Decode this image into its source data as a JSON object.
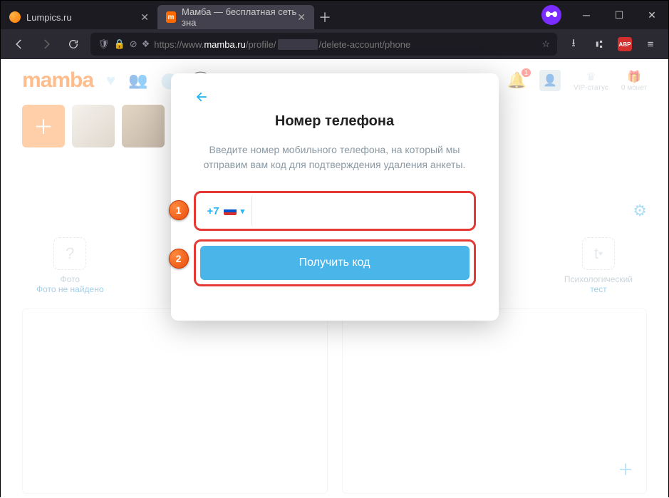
{
  "browser": {
    "tabs": [
      {
        "title": "Lumpics.ru"
      },
      {
        "title": "Мамба — бесплатная сеть зна"
      }
    ],
    "url_prefix": "https://www.",
    "url_host": "mamba.ru",
    "url_path_a": "/profile/",
    "url_path_b": "/delete-account/phone"
  },
  "header": {
    "logo": "mamba",
    "notif_count": "1",
    "vip": "VIP-статус",
    "coins": "0 монет"
  },
  "cards": {
    "photo_line1": "Фото",
    "photo_line2": "Фото не найдено",
    "test_line1": "Психологический",
    "test_line2": "тест"
  },
  "modal": {
    "title": "Номер телефона",
    "desc": "Введите номер мобильного телефона, на который мы отправим вам код для подтверждения удаления анкеты.",
    "country_code": "+7",
    "button": "Получить код"
  },
  "callouts": {
    "one": "1",
    "two": "2"
  }
}
